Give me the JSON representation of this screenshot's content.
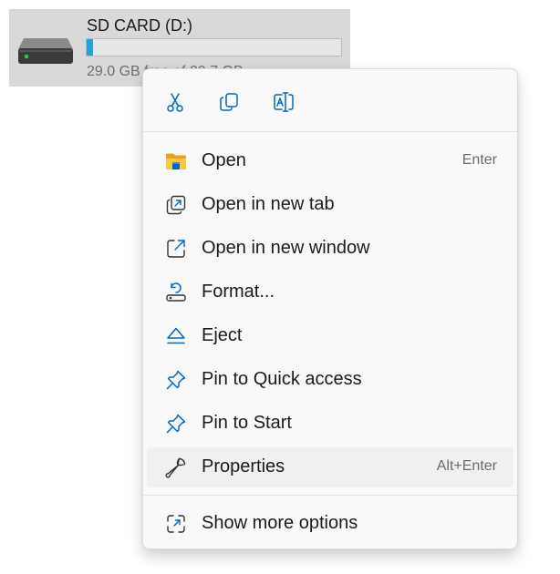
{
  "drive": {
    "name": "SD CARD (D:)",
    "space_text": "29.0 GB free of 29.7 GB",
    "used_fraction": 0.024,
    "accent": "#26a0da"
  },
  "quick_actions": [
    {
      "name": "Cut",
      "icon": "scissors-icon"
    },
    {
      "name": "Copy",
      "icon": "copy-icon"
    },
    {
      "name": "Rename",
      "icon": "rename-icon"
    }
  ],
  "menu": {
    "items": [
      {
        "label": "Open",
        "shortcut": "Enter",
        "icon": "folder-icon"
      },
      {
        "label": "Open in new tab",
        "shortcut": "",
        "icon": "new-tab-icon"
      },
      {
        "label": "Open in new window",
        "shortcut": "",
        "icon": "open-external-icon"
      },
      {
        "label": "Format...",
        "shortcut": "",
        "icon": "format-drive-icon"
      },
      {
        "label": "Eject",
        "shortcut": "",
        "icon": "eject-icon"
      },
      {
        "label": "Pin to Quick access",
        "shortcut": "",
        "icon": "pin-icon"
      },
      {
        "label": "Pin to Start",
        "shortcut": "",
        "icon": "pin-icon"
      },
      {
        "label": "Properties",
        "shortcut": "Alt+Enter",
        "icon": "wrench-icon"
      }
    ],
    "more_options": {
      "label": "Show more options",
      "icon": "expand-icon"
    }
  },
  "colors": {
    "icon_accent": "#0067c0",
    "folder_yellow": "#f9c942",
    "hover_bg": "#f0f0f0"
  }
}
